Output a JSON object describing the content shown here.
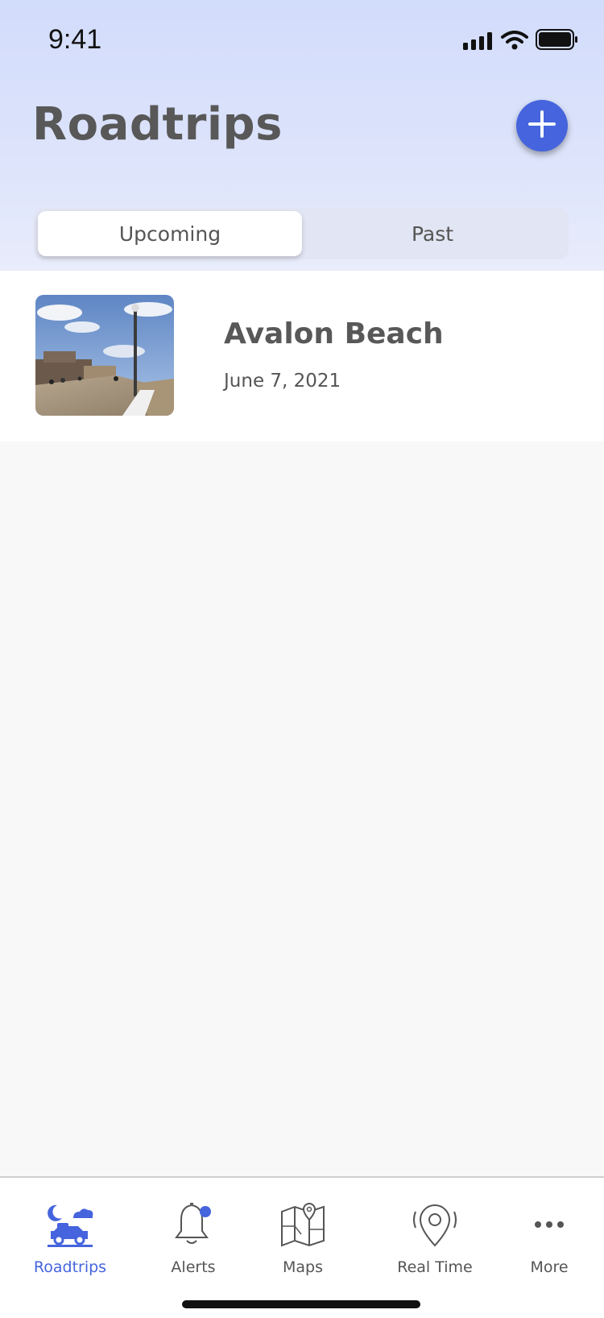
{
  "status_bar": {
    "time": "9:41"
  },
  "header": {
    "title": "Roadtrips",
    "add_icon": "plus-icon"
  },
  "segments": {
    "upcoming": "Upcoming",
    "past": "Past",
    "selected": "Upcoming"
  },
  "trips": [
    {
      "name": "Avalon Beach",
      "date": "June 7, 2021",
      "thumbnail": "boardwalk-photo"
    }
  ],
  "tabbar": {
    "items": [
      {
        "label": "Roadtrips",
        "icon": "car-night-icon",
        "active": true
      },
      {
        "label": "Alerts",
        "icon": "bell-icon",
        "active": false
      },
      {
        "label": "Maps",
        "icon": "map-icon",
        "active": false
      },
      {
        "label": "Real Time",
        "icon": "location-pin-icon",
        "active": false
      },
      {
        "label": "More",
        "icon": "more-dots-icon",
        "active": false
      }
    ]
  },
  "colors": {
    "accent": "#4564dd",
    "text": "#555555",
    "header_bg": "#d2dcfb"
  }
}
